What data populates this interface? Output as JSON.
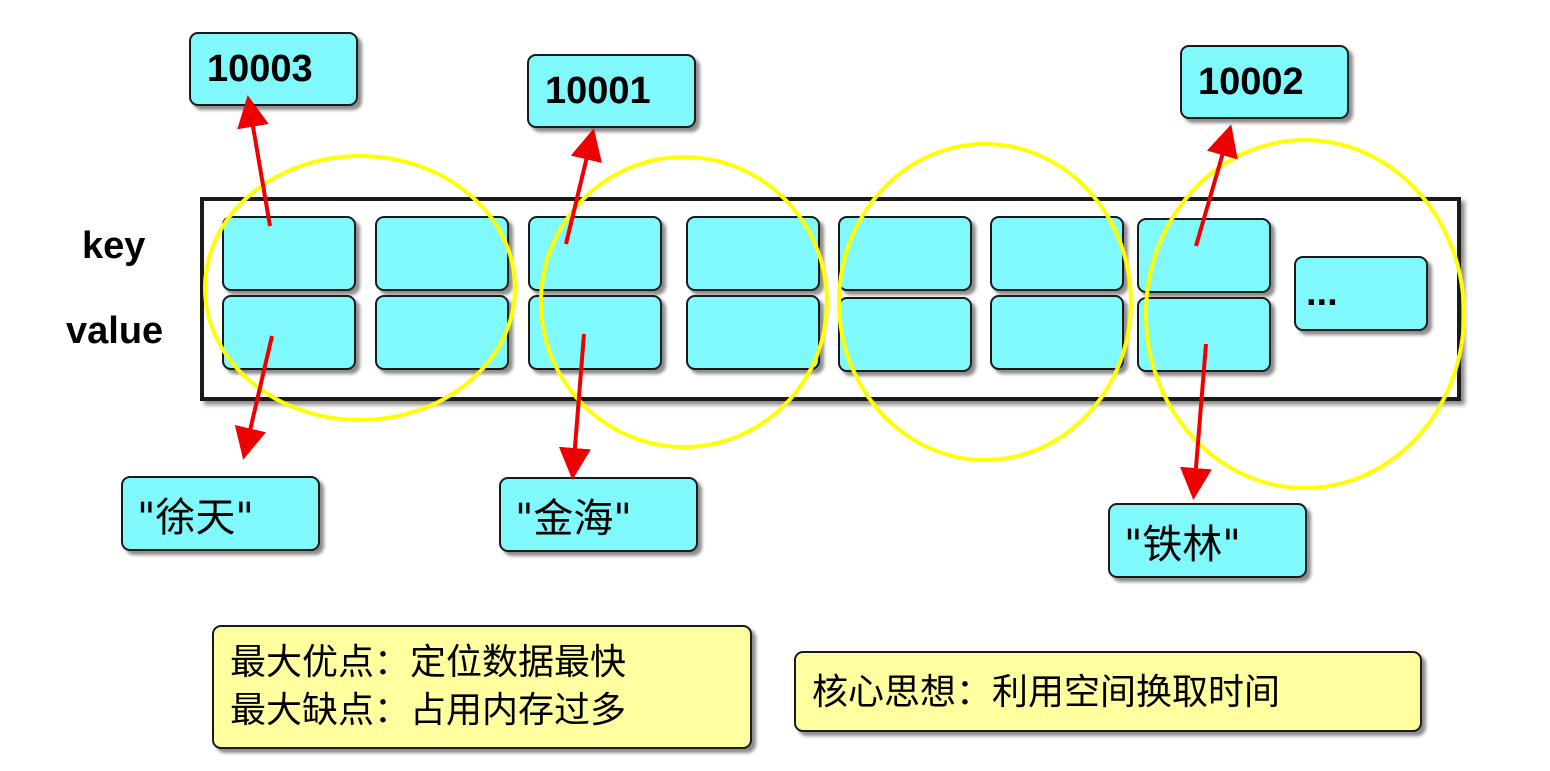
{
  "labels": {
    "key": "key",
    "value": "value"
  },
  "keys": {
    "k1": "10003",
    "k2": "10001",
    "k3": "10002"
  },
  "values": {
    "v1": "\"徐天\"",
    "v2": "\"金海\"",
    "v3": "\"铁林\""
  },
  "ellipsis": "...",
  "notes": {
    "pros": "最大优点：定位数据最快",
    "cons": "最大缺点：占用内存过多",
    "core": "核心思想：利用空间换取时间"
  },
  "colors": {
    "cell": "#7ff9fc",
    "note": "#ffffa0",
    "circle": "#ffff00",
    "arrow": "#ee0000"
  }
}
